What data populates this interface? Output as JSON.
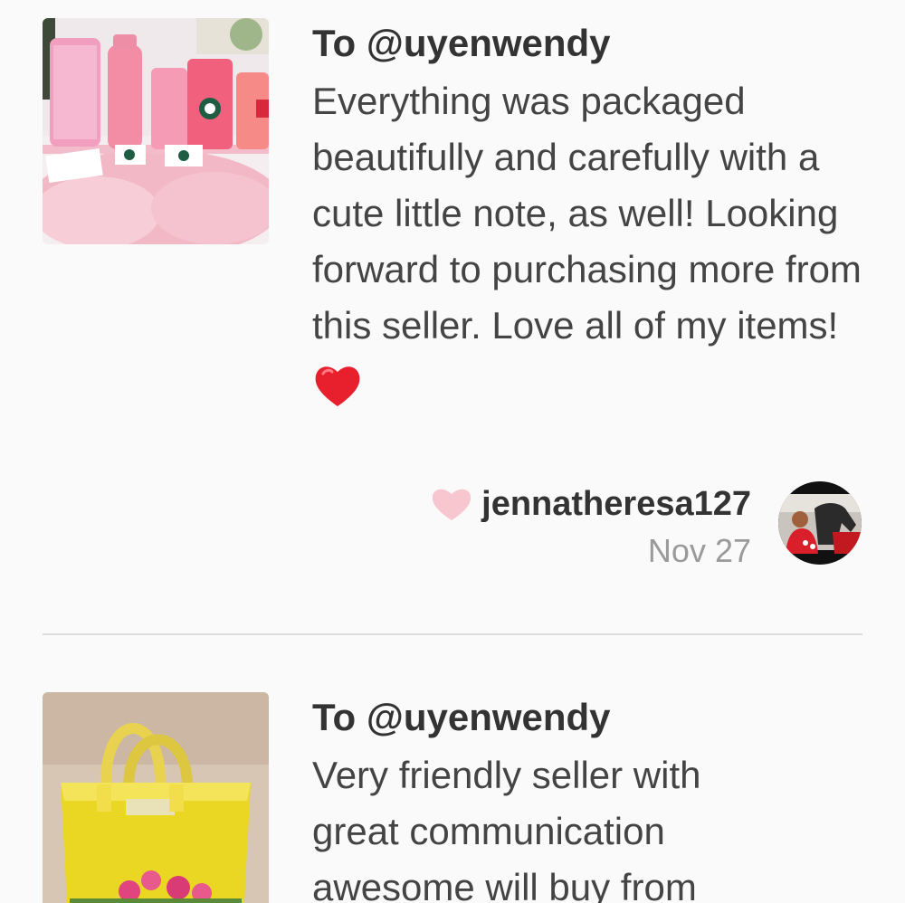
{
  "reviews": [
    {
      "to_line": "To @uyenwendy",
      "body": "Everything was packaged beautifully and carefully with a cute little note, as well! Looking forward to purchasing more from this seller. Love all of my items!",
      "emoji_icon": "red-heart-icon",
      "thumbnail": "pink-tumblers-photo",
      "author": "jennatheresa127",
      "date": "Nov 27",
      "like_icon": "heart-icon",
      "like_color": "#f8c6cf"
    },
    {
      "to_line": "To @uyenwendy",
      "body": "Very friendly seller with great communication awesome will buy from",
      "thumbnail": "yellow-tote-bag-photo"
    }
  ],
  "colors": {
    "background": "#fafafa",
    "text_primary": "#333333",
    "text_secondary": "#9a9a9a",
    "divider": "#dddddd",
    "emoji_heart": "#e8202e"
  }
}
